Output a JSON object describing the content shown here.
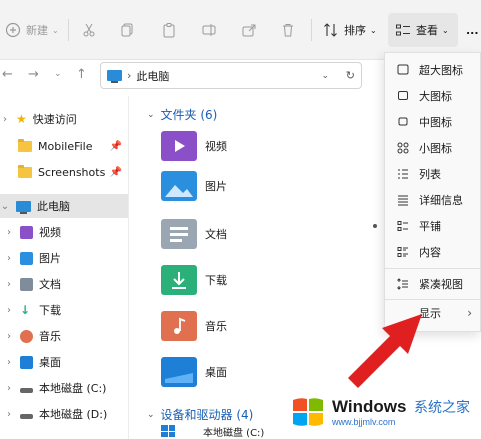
{
  "toolbar": {
    "new_label": "新建",
    "sort_label": "排序",
    "view_label": "查看",
    "more_label": "...",
    "colors": {
      "disabled": "#9a9a9a",
      "active": "#1a1a1a"
    }
  },
  "address": {
    "path_label": "此电脑",
    "chevron": "›"
  },
  "sidebar": {
    "items": [
      {
        "label": "快速访问",
        "icon": "star-icon"
      },
      {
        "label": "MobileFile",
        "icon": "folder-icon",
        "pinned": true
      },
      {
        "label": "Screenshots",
        "icon": "folder-icon",
        "pinned": true
      },
      {
        "label": "此电脑",
        "icon": "pc-icon",
        "selected": true
      },
      {
        "label": "视频",
        "icon": "video-icon"
      },
      {
        "label": "图片",
        "icon": "pictures-icon"
      },
      {
        "label": "文档",
        "icon": "documents-icon"
      },
      {
        "label": "下载",
        "icon": "downloads-icon"
      },
      {
        "label": "音乐",
        "icon": "music-icon"
      },
      {
        "label": "桌面",
        "icon": "desktop-icon"
      },
      {
        "label": "本地磁盘 (C:)",
        "icon": "drive-icon"
      },
      {
        "label": "本地磁盘 (D:)",
        "icon": "drive-icon"
      }
    ]
  },
  "content": {
    "folders_header": "文件夹 (6)",
    "folders": [
      {
        "label": "视频",
        "color": "#8b4fc8"
      },
      {
        "label": "图片",
        "color": "#2b8fe0"
      },
      {
        "label": "文档",
        "color": "#7f8c99"
      },
      {
        "label": "下载",
        "color": "#2bb07a"
      },
      {
        "label": "音乐",
        "color": "#e0704f"
      },
      {
        "label": "桌面",
        "color": "#1e7fd6"
      }
    ],
    "devices_header": "设备和驱动器 (4)",
    "devices": [
      {
        "label": "本地磁盘 (C:)"
      }
    ]
  },
  "menu": {
    "items": [
      {
        "label": "超大图标",
        "icon": "extra-large-icons-icon"
      },
      {
        "label": "大图标",
        "icon": "large-icons-icon"
      },
      {
        "label": "中图标",
        "icon": "medium-icons-icon"
      },
      {
        "label": "小图标",
        "icon": "small-icons-icon"
      },
      {
        "label": "列表",
        "icon": "list-icon"
      },
      {
        "label": "详细信息",
        "icon": "details-icon"
      },
      {
        "label": "平铺",
        "icon": "tiles-icon",
        "selected": true
      },
      {
        "label": "内容",
        "icon": "content-icon"
      },
      {
        "label": "紧凑视图",
        "icon": "compact-view-icon"
      },
      {
        "label": "显示",
        "icon": "show-submenu",
        "submenu": true
      }
    ]
  },
  "watermark": {
    "brand": "Windows",
    "cn": "系统之家",
    "url": "www.bjjmlv.com",
    "accent": "#2a72c8"
  },
  "arrow_color": "#e02020"
}
